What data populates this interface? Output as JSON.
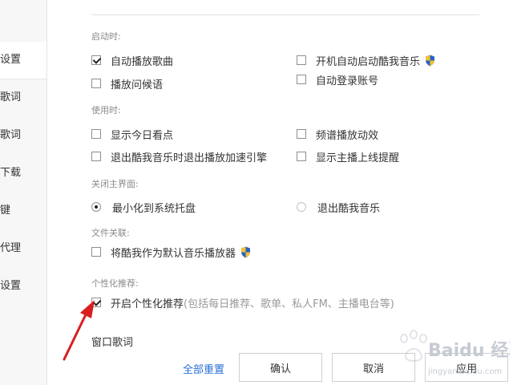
{
  "sidebar": {
    "items": [
      {
        "label": "设置",
        "active": true
      },
      {
        "label": "歌词"
      },
      {
        "label": "歌词"
      },
      {
        "label": "下载"
      },
      {
        "label": "键"
      },
      {
        "label": "代理"
      },
      {
        "label": "设置"
      }
    ]
  },
  "sections": {
    "startup": {
      "title": "启动时:",
      "options": [
        {
          "label": "自动播放歌曲",
          "checked": true
        },
        {
          "label": "开机自动启动酷我音乐",
          "checked": false,
          "icon": "uac-shield-icon"
        },
        {
          "label": "播放问候语",
          "checked": false
        },
        {
          "label": "自动登录账号",
          "checked": false
        }
      ]
    },
    "usage": {
      "title": "使用时:",
      "options": [
        {
          "label": "显示今日看点",
          "checked": false
        },
        {
          "label": "频谱播放动效",
          "checked": false
        },
        {
          "label": "退出酷我音乐时退出播放加速引擎",
          "checked": false
        },
        {
          "label": "显示主播上线提醒",
          "checked": false
        }
      ]
    },
    "close_main": {
      "title": "关闭主界面:",
      "options": [
        {
          "label": "最小化到系统托盘",
          "selected": true
        },
        {
          "label": "退出酷我音乐",
          "selected": false
        }
      ]
    },
    "file_assoc": {
      "title": "文件关联:",
      "options": [
        {
          "label": "将酷我作为默认音乐播放器",
          "checked": false,
          "icon": "uac-shield-icon"
        }
      ]
    },
    "personalization": {
      "title": "个性化推荐:",
      "option": {
        "label": "开启个性化推荐",
        "note": "(包括每日推荐、歌单、私人FM、主播电台等)",
        "checked": true
      }
    },
    "window_lyrics": {
      "title": "窗口歌词"
    }
  },
  "footer": {
    "reset_link": "全部重置",
    "ok_button": "确认",
    "cancel_button": "取消",
    "apply_button": "应用"
  },
  "watermark": {
    "brand": "Baidu 经验",
    "url": "jingyan.baidu.com"
  },
  "colors": {
    "link": "#2a6fd6",
    "annotation_arrow": "#d91e1e",
    "section_title": "#8a8a8a"
  }
}
